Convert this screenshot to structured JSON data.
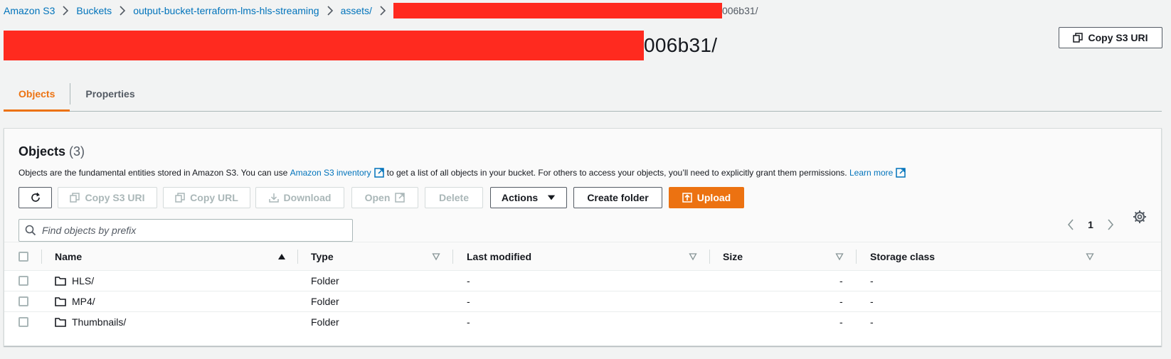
{
  "breadcrumb": {
    "items": [
      "Amazon S3",
      "Buckets",
      "output-bucket-terraform-lms-hls-streaming",
      "assets/"
    ],
    "current_suffix": "006b31/"
  },
  "header": {
    "title_suffix": "006b31/",
    "copy_s3_uri": "Copy S3 URI"
  },
  "tabs": [
    {
      "label": "Objects",
      "active": true
    },
    {
      "label": "Properties",
      "active": false
    }
  ],
  "objects_panel": {
    "title": "Objects",
    "count": "(3)",
    "desc_1": "Objects are the fundamental entities stored in Amazon S3. You can use",
    "inventory_link": "Amazon S3 inventory",
    "desc_2": "to get a list of all objects in your bucket. For others to access your objects, you’ll need to explicitly grant them permissions.",
    "learn_more": "Learn more"
  },
  "toolbar": {
    "copy_s3_uri": "Copy S3 URI",
    "copy_url": "Copy URL",
    "download": "Download",
    "open": "Open",
    "delete": "Delete",
    "actions": "Actions",
    "create_folder": "Create folder",
    "upload": "Upload"
  },
  "search": {
    "placeholder": "Find objects by prefix",
    "value": ""
  },
  "pagination": {
    "page": "1"
  },
  "table": {
    "columns": [
      "Name",
      "Type",
      "Last modified",
      "Size",
      "Storage class"
    ],
    "rows": [
      {
        "name": "HLS/",
        "type": "Folder",
        "last_modified": "-",
        "size": "-",
        "storage_class": "-"
      },
      {
        "name": "MP4/",
        "type": "Folder",
        "last_modified": "-",
        "size": "-",
        "storage_class": "-"
      },
      {
        "name": "Thumbnails/",
        "type": "Folder",
        "last_modified": "-",
        "size": "-",
        "storage_class": "-"
      }
    ]
  },
  "colors": {
    "link": "#0073bb",
    "accent": "#ec7211",
    "redaction": "#ff2a1f",
    "background": "#f2f3f3"
  }
}
